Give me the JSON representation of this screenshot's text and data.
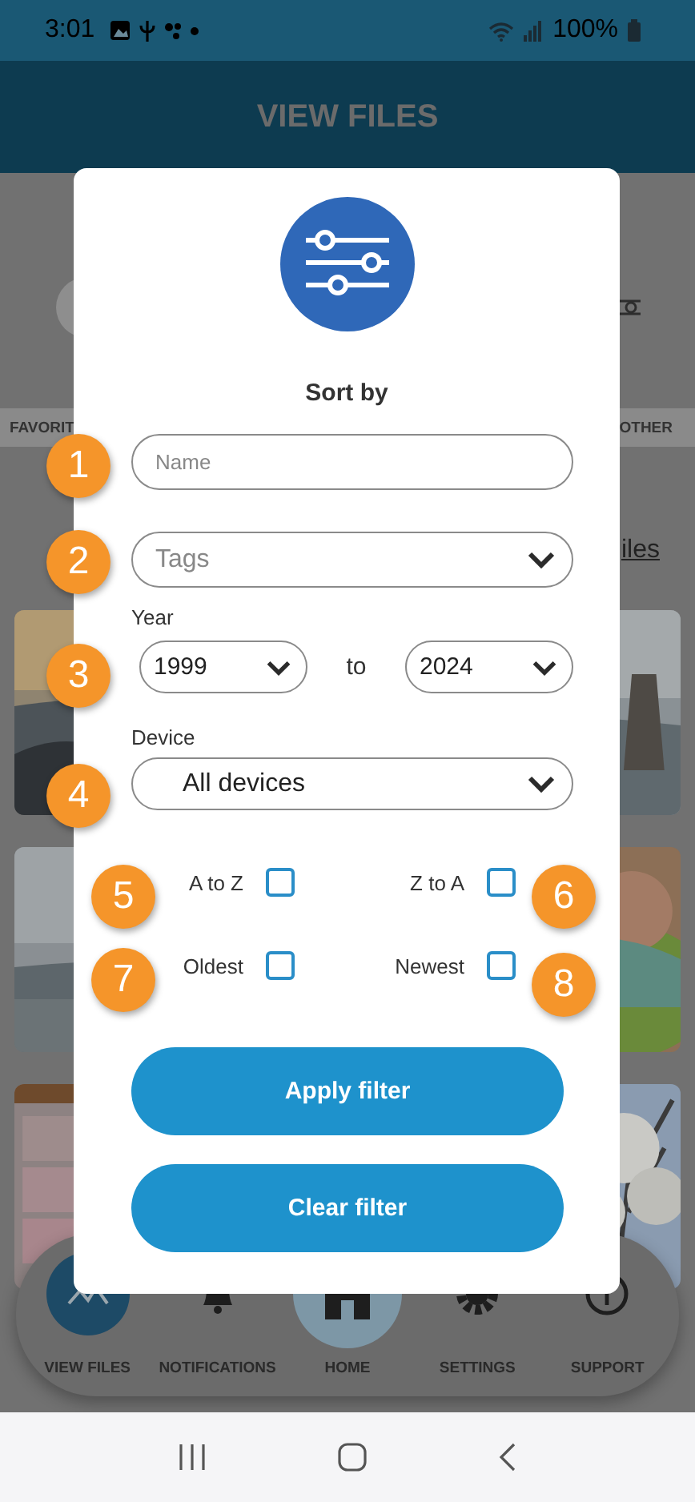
{
  "status_bar": {
    "time": "3:01",
    "battery": "100%"
  },
  "header": {
    "title": "VIEW FILES"
  },
  "category_tabs": [
    {
      "label": "FAVORIT"
    },
    {
      "label": "OTHER"
    }
  ],
  "partial_link": "iles",
  "modal": {
    "title": "Sort by",
    "name_field": {
      "placeholder": "Name"
    },
    "tags_select": {
      "placeholder": "Tags"
    },
    "year_label": "Year",
    "year_from": "1999",
    "year_separator": "to",
    "year_to": "2024",
    "device_label": "Device",
    "device_select": {
      "value": "All devices"
    },
    "sort_options": [
      {
        "label": "A to Z",
        "checked": false
      },
      {
        "label": "Z to A",
        "checked": false
      },
      {
        "label": "Oldest",
        "checked": false
      },
      {
        "label": "Newest",
        "checked": false
      }
    ],
    "buttons": [
      "Apply filter",
      "Clear filter"
    ]
  },
  "callouts": [
    "1",
    "2",
    "3",
    "4",
    "5",
    "6",
    "7",
    "8"
  ],
  "bottom_nav": [
    {
      "label": "VIEW FILES",
      "selected": true
    },
    {
      "label": "NOTIFICATIONS",
      "selected": false
    },
    {
      "label": "HOME",
      "selected": false
    },
    {
      "label": "SETTINGS",
      "selected": false
    },
    {
      "label": "SUPPORT",
      "selected": false
    }
  ]
}
